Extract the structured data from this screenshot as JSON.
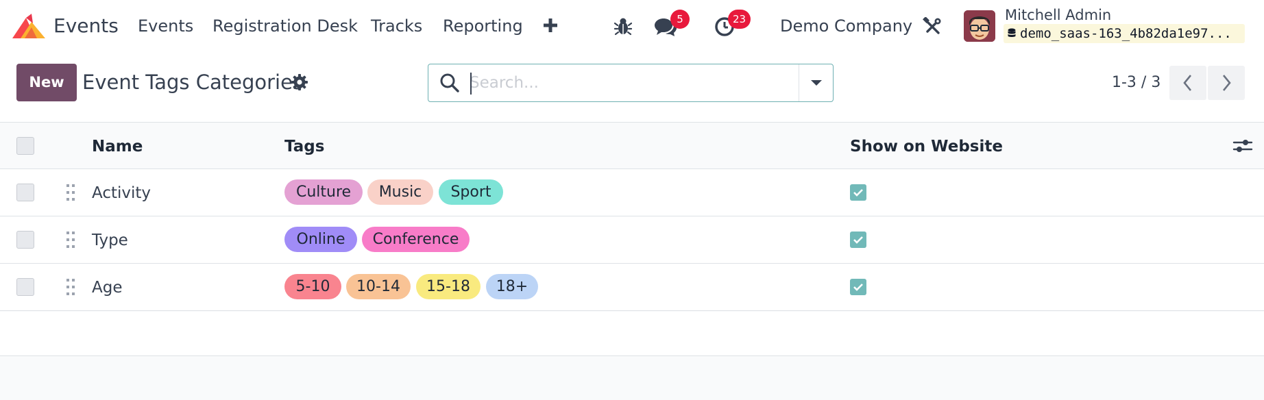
{
  "app": {
    "name": "Events"
  },
  "nav_menu": [
    "Events",
    "Registration Desk",
    "Tracks",
    "Reporting"
  ],
  "systray": {
    "messages_count": "5",
    "activities_count": "23",
    "company": "Demo Company",
    "user_name": "Mitchell Admin",
    "database": "demo_saas-163_4b82da1e97..."
  },
  "control_panel": {
    "new_label": "New",
    "title": "Event Tags Categories",
    "search_placeholder": "Search...",
    "pager": "1-3 / 3"
  },
  "table": {
    "columns": [
      "Name",
      "Tags",
      "Show on Website"
    ],
    "rows": [
      {
        "name": "Activity",
        "tags": [
          {
            "label": "Culture",
            "color": "#e4a1d3"
          },
          {
            "label": "Music",
            "color": "#f9d1c8"
          },
          {
            "label": "Sport",
            "color": "#7de3d6"
          }
        ],
        "show_on_website": true
      },
      {
        "name": "Type",
        "tags": [
          {
            "label": "Online",
            "color": "#a08cf7"
          },
          {
            "label": "Conference",
            "color": "#f87cc8"
          }
        ],
        "show_on_website": true
      },
      {
        "name": "Age",
        "tags": [
          {
            "label": "5-10",
            "color": "#f9848f"
          },
          {
            "label": "10-14",
            "color": "#f9c395"
          },
          {
            "label": "15-18",
            "color": "#f9ea7f"
          },
          {
            "label": "18+",
            "color": "#bcd4f6"
          }
        ],
        "show_on_website": true
      }
    ]
  },
  "colors": {
    "brand": "#714b67",
    "badge": "#e8193c",
    "checkbox_checked": "#71b9b8",
    "search_border": "#6db0b2"
  }
}
